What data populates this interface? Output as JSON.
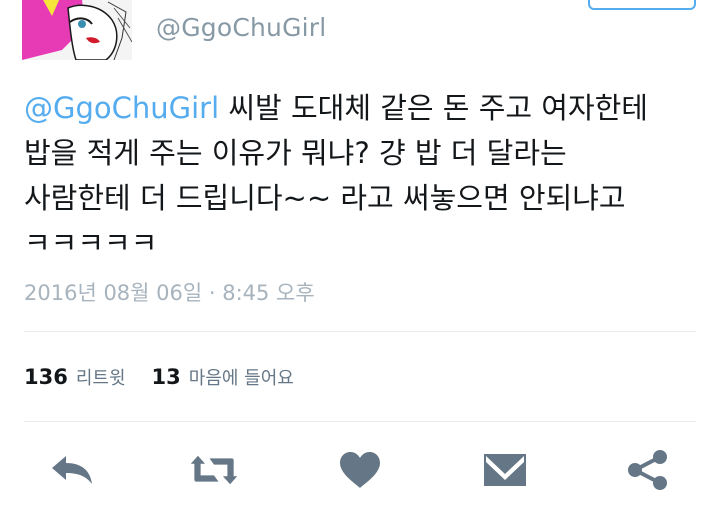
{
  "tweet": {
    "handle": "@GgoChuGirl",
    "mention": "@GgoChuGirl",
    "text_line1_rest": " 씨발 도대체 같은 돈 주고 여자한테",
    "text_line2": "밥을 적게 주는 이유가 뭐냐? 걍 밥 더 달라는",
    "text_line3": "사람한테 더 드립니다~~ 라고 써놓으면 안되냐고",
    "text_line4": "ㅋㅋㅋㅋㅋ",
    "timestamp": "2016년 08월 06일 · 8:45 오후"
  },
  "stats": {
    "retweets_count": "136",
    "retweets_label": "리트윗",
    "likes_count": "13",
    "likes_label": "마음에 들어요"
  },
  "actions": {
    "reply_icon": "reply-icon",
    "retweet_icon": "retweet-icon",
    "like_icon": "heart-icon",
    "message_icon": "envelope-icon",
    "share_icon": "share-icon"
  },
  "colors": {
    "accent": "#55acee",
    "action_icon": "#657786",
    "muted_text": "#8899a6",
    "divider": "#e6ecf0"
  }
}
